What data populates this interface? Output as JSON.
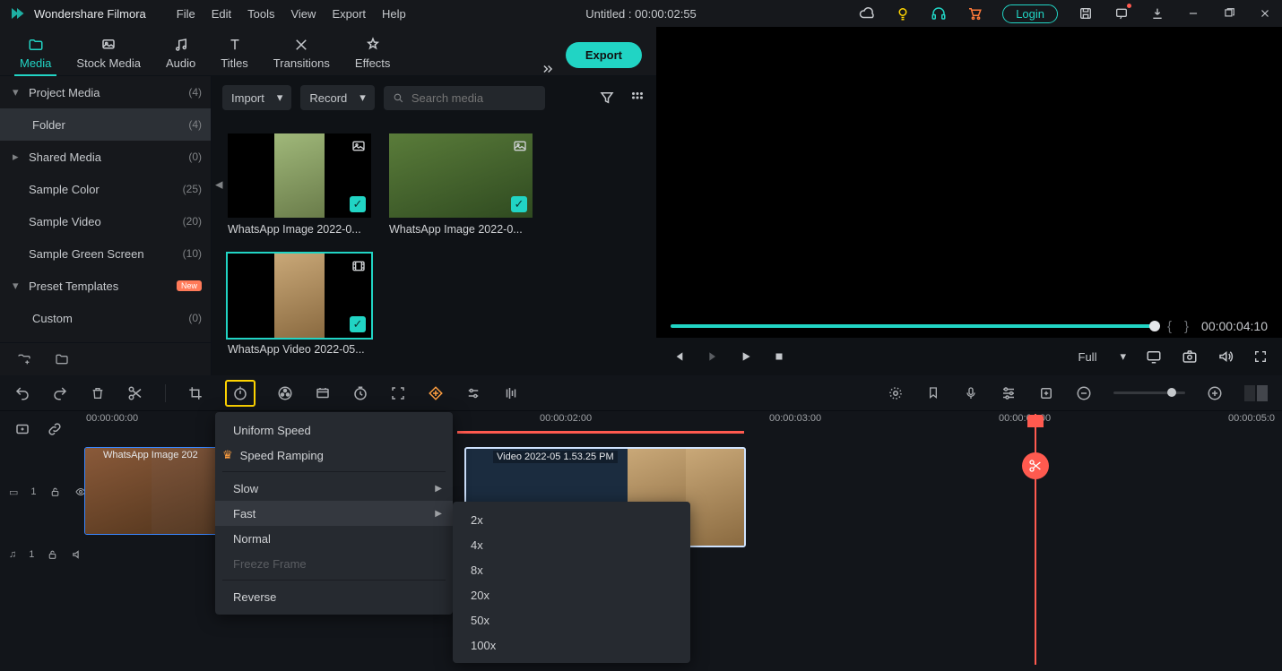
{
  "app": {
    "name": "Wondershare Filmora"
  },
  "menu": [
    "File",
    "Edit",
    "Tools",
    "View",
    "Export",
    "Help"
  ],
  "doc_title": "Untitled : 00:00:02:55",
  "login": "Login",
  "tabs": [
    {
      "id": "media",
      "label": "Media"
    },
    {
      "id": "stock",
      "label": "Stock Media"
    },
    {
      "id": "audio",
      "label": "Audio"
    },
    {
      "id": "titles",
      "label": "Titles"
    },
    {
      "id": "transitions",
      "label": "Transitions"
    },
    {
      "id": "effects",
      "label": "Effects"
    }
  ],
  "export_label": "Export",
  "import_label": "Import",
  "record_label": "Record",
  "search_placeholder": "Search media",
  "sidebar": [
    {
      "label": "Project Media",
      "count": "(4)",
      "chev": "▾"
    },
    {
      "label": "Folder",
      "count": "(4)",
      "sub": true,
      "sel": true
    },
    {
      "label": "Shared Media",
      "count": "(0)",
      "chev": "▸"
    },
    {
      "label": "Sample Color",
      "count": "(25)"
    },
    {
      "label": "Sample Video",
      "count": "(20)"
    },
    {
      "label": "Sample Green Screen",
      "count": "(10)"
    },
    {
      "label": "Preset Templates",
      "count": "",
      "chev": "▾",
      "new": true
    },
    {
      "label": "Custom",
      "count": "(0)",
      "sub": true
    }
  ],
  "clips": [
    {
      "name": "WhatsApp Image 2022-0...",
      "type": "img",
      "check": true,
      "cls": "inner"
    },
    {
      "name": "WhatsApp Image 2022-0...",
      "type": "img",
      "check": true,
      "cls": "inner2"
    },
    {
      "name": "WhatsApp Video 2022-05...",
      "type": "vid",
      "check": true,
      "cls": "inner3",
      "sel": true
    }
  ],
  "preview": {
    "time": "00:00:04:10",
    "quality": "Full"
  },
  "ruler": [
    "00:00:00:00",
    "00:00:02:00",
    "00:00:03:00",
    "00:00:04:00",
    "00:00:05:0"
  ],
  "track1_label": "1",
  "audio_label": "1",
  "clip_img_label": "WhatsApp Image 202",
  "clip_vid_label": "Video 2022-05    1.53.25 PM",
  "ctx": {
    "uniform": "Uniform Speed",
    "ramping": "Speed Ramping",
    "slow": "Slow",
    "fast": "Fast",
    "normal": "Normal",
    "freeze": "Freeze Frame",
    "reverse": "Reverse"
  },
  "speeds": [
    "2x",
    "4x",
    "8x",
    "20x",
    "50x",
    "100x"
  ]
}
